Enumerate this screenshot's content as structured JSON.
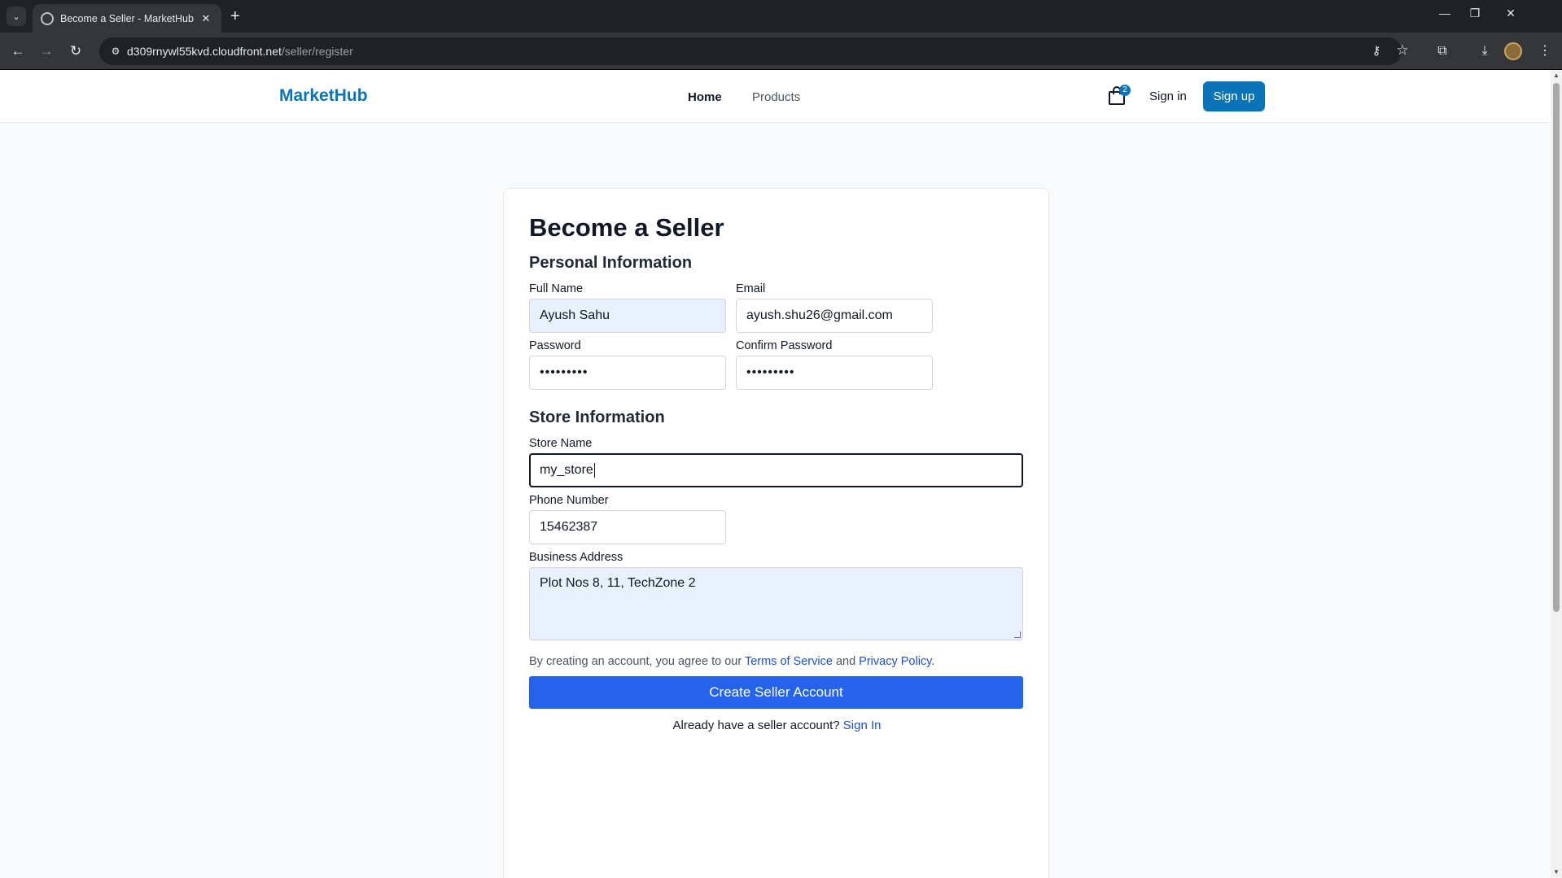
{
  "browser": {
    "tab_title": "Become a Seller - MarketHub",
    "tab_close": "✕",
    "new_tab": "+",
    "url_host": "d309rnywl55kvd.cloudfront.net",
    "url_path": "/seller/register"
  },
  "header": {
    "logo": "MarketHub",
    "nav": [
      "Home",
      "Products"
    ],
    "cart_count": "2",
    "signin": "Sign in",
    "signup": "Sign up"
  },
  "form": {
    "title": "Become a Seller",
    "personal_section": "Personal Information",
    "store_section": "Store Information",
    "full_name": {
      "label": "Full Name",
      "value": "Ayush Sahu"
    },
    "email": {
      "label": "Email",
      "value": "ayush.shu26@gmail.com"
    },
    "password": {
      "label": "Password",
      "value": "•••••••••"
    },
    "confirm_password": {
      "label": "Confirm Password",
      "value": "•••••••••"
    },
    "store_name": {
      "label": "Store Name",
      "value": "my_store"
    },
    "phone": {
      "label": "Phone Number",
      "value": "15462387"
    },
    "address": {
      "label": "Business Address",
      "value": "Plot Nos 8, 11, TechZone 2"
    },
    "terms_prefix": "By creating an account, you agree to our ",
    "terms_link": "Terms of Service",
    "terms_and": " and ",
    "privacy_link": "Privacy Policy",
    "terms_suffix": ".",
    "submit": "Create Seller Account",
    "already_text": "Already have a seller account? ",
    "already_link": "Sign In"
  },
  "colors": {
    "brand": "#0b73b8",
    "primary_button": "#2563eb",
    "autofill": "#e8f0fe"
  }
}
